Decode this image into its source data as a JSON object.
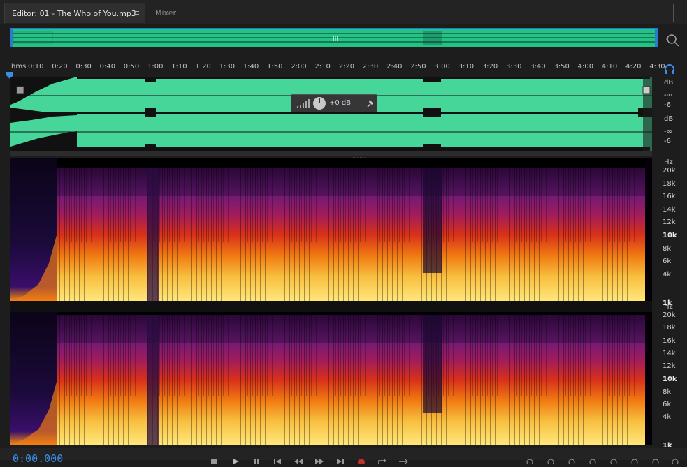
{
  "tabs": {
    "editor_label": "Editor: 01 - The Who of You.mp3",
    "editor_menu": "≡",
    "mixer_label": "Mixer"
  },
  "ruler": {
    "unit_label": "hms",
    "ticks": [
      "0:10",
      "0:20",
      "0:30",
      "0:40",
      "0:50",
      "1:00",
      "1:10",
      "1:20",
      "1:30",
      "1:40",
      "1:50",
      "2:00",
      "2:10",
      "2:20",
      "2:30",
      "2:40",
      "2:50",
      "3:00",
      "3:10",
      "3:20",
      "3:30",
      "3:40",
      "3:50",
      "4:00",
      "4:10",
      "4:20",
      "4:30"
    ]
  },
  "hud": {
    "volume_value": "+0 dB"
  },
  "amplitude_scale": {
    "channel1": [
      "dB",
      "-∞",
      "-6"
    ],
    "channel2": [
      "dB",
      "-∞",
      "-6"
    ]
  },
  "frequency_scale": {
    "unit": "Hz",
    "labels": [
      "20k",
      "18k",
      "16k",
      "14k",
      "12k",
      "10k",
      "8k",
      "6k",
      "4k",
      "1k"
    ],
    "bold_labels": [
      "10k",
      "1k"
    ]
  },
  "transport": {
    "timecode": "0:00.000",
    "accent": "#3b8ee8",
    "record_color": "#c0302b"
  },
  "colors": {
    "waveform_fill": "#46d699",
    "waveform_dark": "#111111",
    "overview_border": "#2a7ad0"
  },
  "icons": [
    "zoom-icon",
    "headphone-icon",
    "play-icon",
    "pause-icon",
    "stop-icon",
    "go-to-start-icon",
    "rewind-icon",
    "fast-forward-icon",
    "go-to-end-icon",
    "record-icon",
    "loop-icon",
    "skip-selection-icon",
    "zoom-in-amplitude-icon",
    "zoom-out-amplitude-icon",
    "zoom-in-time-icon",
    "zoom-out-time-icon",
    "zoom-full-icon",
    "zoom-in-selection-icon",
    "zoom-in-left-icon",
    "zoom-in-right-icon"
  ]
}
